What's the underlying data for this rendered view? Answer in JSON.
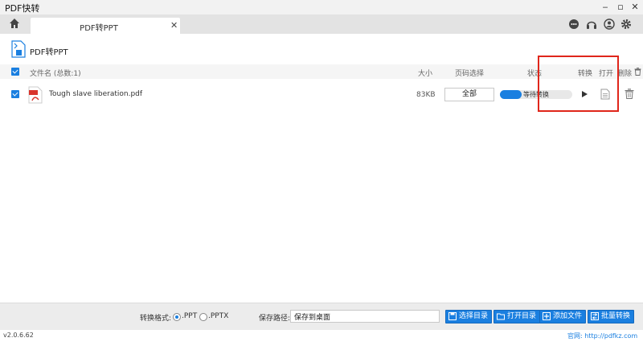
{
  "window": {
    "title": "PDF快转",
    "minimize": "‒",
    "maximize": "▫",
    "close": "✕"
  },
  "tab": {
    "label": "PDF转PPT",
    "close": "✕"
  },
  "feature": {
    "title": "PDF转PPT"
  },
  "table": {
    "headers": {
      "filename": "文件名 (总数:1)",
      "size": "大小",
      "page_select": "页码选择",
      "status": "状态",
      "convert": "转换",
      "open": "打开",
      "delete": "删除"
    },
    "rows": [
      {
        "name": "Tough slave liberation.pdf",
        "size": "83KB",
        "pages": "全部",
        "status": "等待转换",
        "progress": 0.3
      }
    ]
  },
  "bottom": {
    "format_label": "转换格式:",
    "formats": [
      ".PPT",
      ".PPTX"
    ],
    "selected_format": ".PPT",
    "save_label": "保存路径:",
    "save_value": "保存到桌面",
    "buttons": {
      "choose_dir": "选择目录",
      "open_dir": "打开目录",
      "add_file": "添加文件",
      "batch_convert": "批量转换"
    }
  },
  "footer": {
    "version": "v2.0.6.62",
    "site": "官网: http://pdfkz.com"
  },
  "colors": {
    "accent": "#1a7fe0",
    "highlight": "#e0261b"
  }
}
